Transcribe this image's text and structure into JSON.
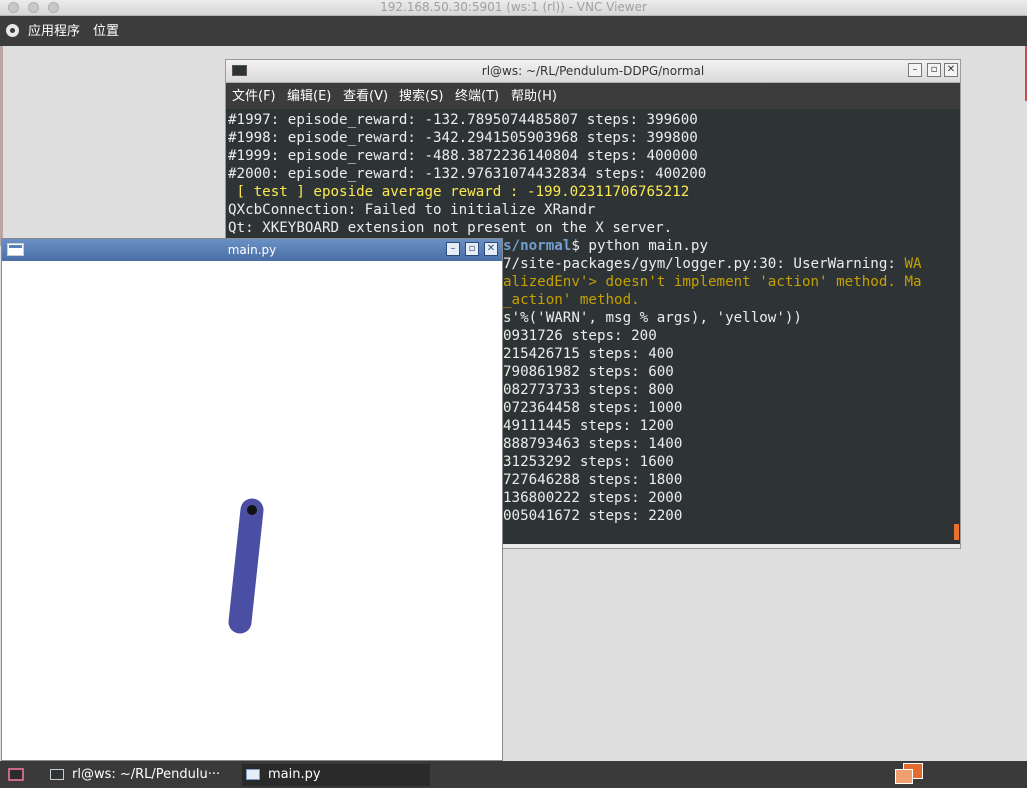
{
  "vnc": {
    "title": "192.168.50.30:5901 (ws:1 (rl)) - VNC Viewer"
  },
  "top_panel": {
    "apps": "应用程序",
    "places": "位置"
  },
  "terminal": {
    "title": "rl@ws: ~/RL/Pendulum-DDPG/normal",
    "menu": [
      "文件(F)",
      "编辑(E)",
      "查看(V)",
      "搜索(S)",
      "终端(T)",
      "帮助(H)"
    ],
    "lines_top": [
      "#1997: episode_reward: -132.7895074485807 steps: 399600",
      "#1998: episode_reward: -342.2941505903968 steps: 399800",
      "#1999: episode_reward: -488.3872236140804 steps: 400000",
      "#2000: episode_reward: -132.97631074432834 steps: 400200",
      " [ test ] eposide average reward : -199.02311706765212",
      "QXcbConnection: Failed to initialize XRandr",
      "Qt: XKEYBOARD extension not present on the X server."
    ],
    "prompt_path": "s/normal",
    "prompt_cmd": "$ python main.py",
    "warn_prefix": "7/site-packages/gym/logger.py:30: UserWarning: ",
    "warn_a": "WA",
    "warn_b": "alizedEnv'> doesn't implement 'action' method. Ma",
    "warn_c": "_action' method.",
    "warn_d": "s'%('WARN', msg % args), 'yellow'))",
    "lines_bottom": [
      "0931726 steps: 200",
      "215426715 steps: 400",
      "790861982 steps: 600",
      "082773733 steps: 800",
      "072364458 steps: 1000",
      "49111445 steps: 1200",
      "888793463 steps: 1400",
      "31253292 steps: 1600",
      "727646288 steps: 1800",
      "136800222 steps: 2000",
      "005041672 steps: 2200"
    ]
  },
  "pendulum": {
    "title": "main.py",
    "rod_color": "#4b4fa3",
    "pivot_color": "#111111"
  },
  "taskbar": {
    "terminal_task": "rl@ws: ~/RL/Pendulu···",
    "pendulum_task": "main.py"
  }
}
